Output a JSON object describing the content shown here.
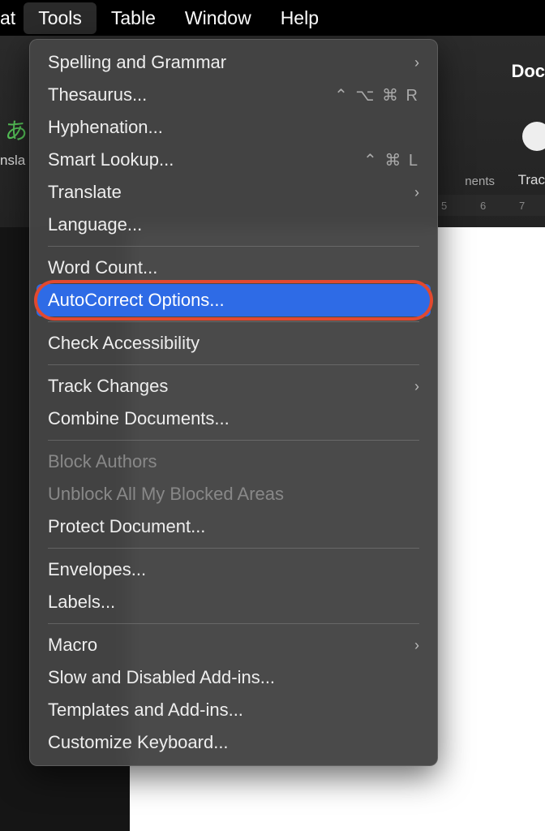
{
  "menubar": {
    "items": [
      "at",
      "Tools",
      "Table",
      "Window",
      "Help"
    ],
    "activeIndex": 1
  },
  "background": {
    "docLabel": "Doc",
    "translateIconLabel": "あ",
    "translateLabel": "nsla",
    "commentsLabel": "nents",
    "trackLabel": "Trac",
    "ruler": [
      "5",
      "6",
      "7"
    ]
  },
  "menu": {
    "groups": [
      {
        "items": [
          {
            "label": "Spelling and Grammar",
            "submenu": true
          },
          {
            "label": "Thesaurus...",
            "shortcut": "⌃ ⌥ ⌘ R"
          },
          {
            "label": "Hyphenation..."
          },
          {
            "label": "Smart Lookup...",
            "shortcut": "⌃ ⌘ L"
          },
          {
            "label": "Translate",
            "submenu": true
          },
          {
            "label": "Language..."
          }
        ]
      },
      {
        "items": [
          {
            "label": "Word Count..."
          },
          {
            "label": "AutoCorrect Options...",
            "highlighted": true
          }
        ]
      },
      {
        "items": [
          {
            "label": "Check Accessibility"
          }
        ]
      },
      {
        "items": [
          {
            "label": "Track Changes",
            "submenu": true
          },
          {
            "label": "Combine Documents..."
          }
        ]
      },
      {
        "items": [
          {
            "label": "Block Authors",
            "disabled": true
          },
          {
            "label": "Unblock All My Blocked Areas",
            "disabled": true
          },
          {
            "label": "Protect Document..."
          }
        ]
      },
      {
        "items": [
          {
            "label": "Envelopes..."
          },
          {
            "label": "Labels..."
          }
        ]
      },
      {
        "items": [
          {
            "label": "Macro",
            "submenu": true
          },
          {
            "label": "Slow and Disabled Add-ins..."
          },
          {
            "label": "Templates and Add-ins..."
          },
          {
            "label": "Customize Keyboard..."
          }
        ]
      }
    ]
  }
}
